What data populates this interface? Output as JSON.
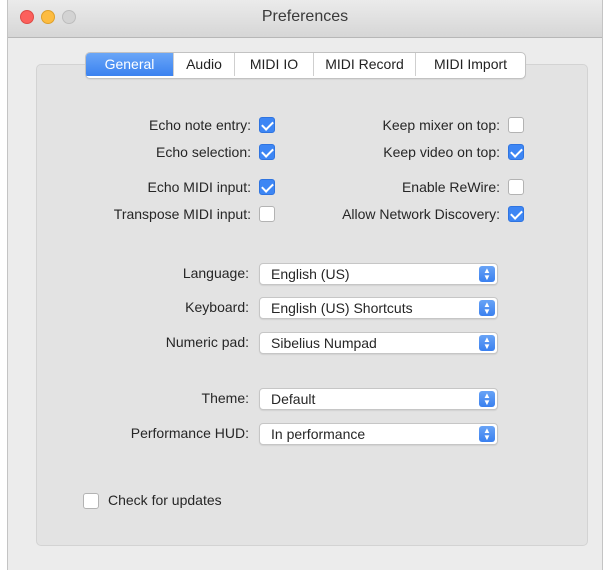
{
  "window": {
    "title": "Preferences"
  },
  "tabs": [
    {
      "label": "General",
      "active": true
    },
    {
      "label": "Audio",
      "active": false
    },
    {
      "label": "MIDI IO",
      "active": false
    },
    {
      "label": "MIDI Record",
      "active": false
    },
    {
      "label": "MIDI Import",
      "active": false
    }
  ],
  "options_left": [
    {
      "label": "Echo note entry:",
      "checked": true
    },
    {
      "label": "Echo selection:",
      "checked": true
    },
    {
      "label": "Echo MIDI input:",
      "checked": true
    },
    {
      "label": "Transpose MIDI input:",
      "checked": false
    }
  ],
  "options_right": [
    {
      "label": "Keep mixer on top:",
      "checked": false
    },
    {
      "label": "Keep video on top:",
      "checked": true
    },
    {
      "label": "Enable ReWire:",
      "checked": false
    },
    {
      "label": "Allow Network Discovery:",
      "checked": true
    }
  ],
  "selects": [
    {
      "label": "Language:",
      "value": "English (US)"
    },
    {
      "label": "Keyboard:",
      "value": "English (US) Shortcuts"
    },
    {
      "label": "Numeric pad:",
      "value": "Sibelius Numpad"
    },
    {
      "label": "Theme:",
      "value": "Default"
    },
    {
      "label": "Performance HUD:",
      "value": "In performance"
    }
  ],
  "updates": {
    "label": "Check for updates",
    "checked": false
  },
  "colors": {
    "accent": "#3d86f4",
    "close": "#fc605c",
    "minimize": "#fdbc40"
  }
}
